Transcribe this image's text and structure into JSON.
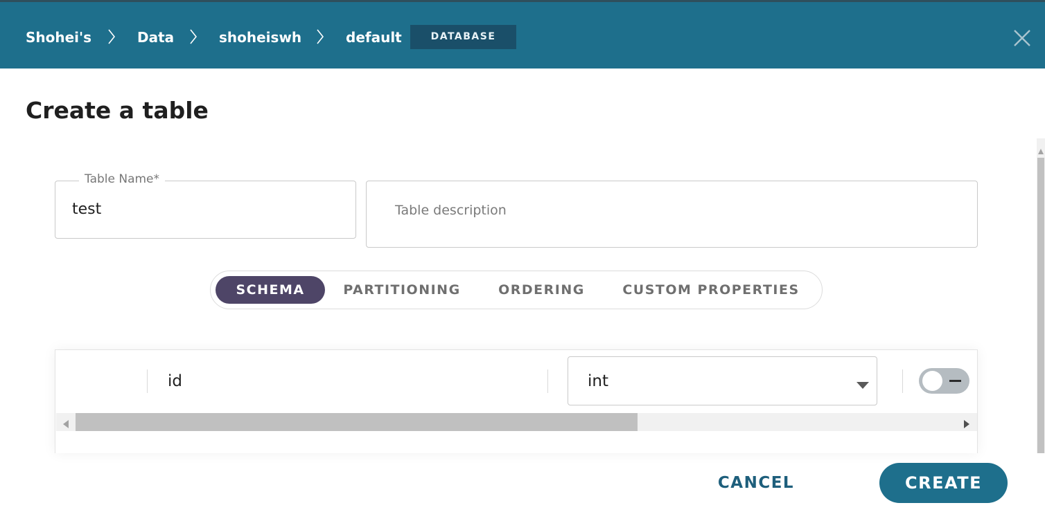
{
  "breadcrumb": {
    "items": [
      "Shohei's",
      "Data",
      "shoheiswh",
      "default"
    ],
    "badge": "DATABASE"
  },
  "dialog": {
    "title": "Create a table",
    "close_icon": "close-icon"
  },
  "form": {
    "table_name_label": "Table Name",
    "table_name_required_mark": "*",
    "table_name_value": "test",
    "description_placeholder": "Table description"
  },
  "tabs": [
    {
      "label": "SCHEMA",
      "active": true
    },
    {
      "label": "PARTITIONING",
      "active": false
    },
    {
      "label": "ORDERING",
      "active": false
    },
    {
      "label": "CUSTOM PROPERTIES",
      "active": false
    }
  ],
  "schema": {
    "rows": [
      {
        "name": "id",
        "type": "int",
        "nullable_toggle": "off"
      }
    ]
  },
  "footer": {
    "cancel_label": "CANCEL",
    "create_label": "CREATE"
  },
  "colors": {
    "header_bg": "#1e6f8c",
    "badge_bg": "#1a4f69",
    "active_tab_bg": "#4e4567",
    "primary_button": "#1e6f8c",
    "cancel_text": "#1e5f7c"
  }
}
